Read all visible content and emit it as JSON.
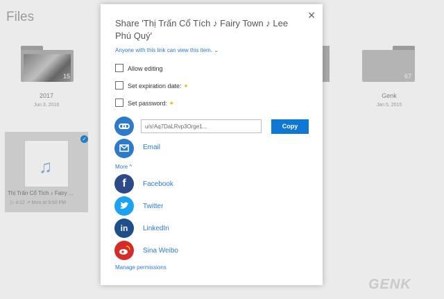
{
  "page_title": "Files",
  "background_items": [
    {
      "name": "2017",
      "date": "Jun 3, 2018",
      "count": "15"
    },
    {
      "name": "Genk",
      "date": "Jan 5, 2015",
      "count": "67"
    }
  ],
  "selected_item": {
    "name": "Thị Trấn Cổ Tích ♪ Fairy ...",
    "duration": "4:12",
    "modified": "Mon at 9:50 PM"
  },
  "share_dialog": {
    "title": "Share 'Thị Trấn Cổ Tích ♪ Fairy Town ♪ Lee Phú Quý'",
    "permission_text": "Anyone with this link can view this item.",
    "options": [
      "Allow editing",
      "Set expiration date:",
      "Set password:"
    ],
    "link_value": "u/s!Aq7DaLRvp3Orge1...",
    "copy_label": "Copy",
    "email_label": "Email",
    "more_label": "More",
    "social": [
      "Facebook",
      "Twitter",
      "LinkedIn",
      "Sina Weibo"
    ],
    "manage_label": "Manage permissions"
  },
  "watermark": "GENK",
  "colors": {
    "accent": "#0f78d4",
    "facebook": "#2b4a87",
    "twitter": "#1da1f2",
    "linkedin": "#1f4f8a",
    "weibo": "#d62b2b",
    "link_blue": "#2c7ac9"
  },
  "icons": [
    "link-icon",
    "email-icon",
    "facebook-icon",
    "twitter-icon",
    "linkedin-icon",
    "weibo-icon",
    "close-icon",
    "chevron-down-icon",
    "chevron-up-icon",
    "star-icon",
    "music-note-icon",
    "checkmark-icon"
  ]
}
